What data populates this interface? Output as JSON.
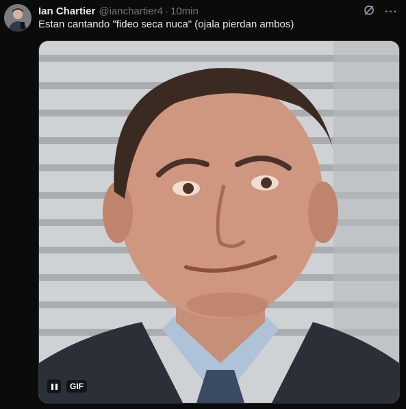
{
  "tweet": {
    "author_name": "Ian Chartier",
    "handle": "@ianchartier4",
    "separator": "·",
    "time": "10min",
    "text": "Estan cantando \"fideo seca nuca\" (ojala pierdan ambos)",
    "actions": {
      "grok_icon": "grok-icon",
      "more_icon": "more-icon",
      "more_glyph": "···"
    },
    "media": {
      "type": "gif",
      "badge": "GIF",
      "description_icon": "pause-icon"
    }
  },
  "colors": {
    "background": "#0b0b0b",
    "text": "#e7e9ea",
    "muted": "#71767b"
  }
}
